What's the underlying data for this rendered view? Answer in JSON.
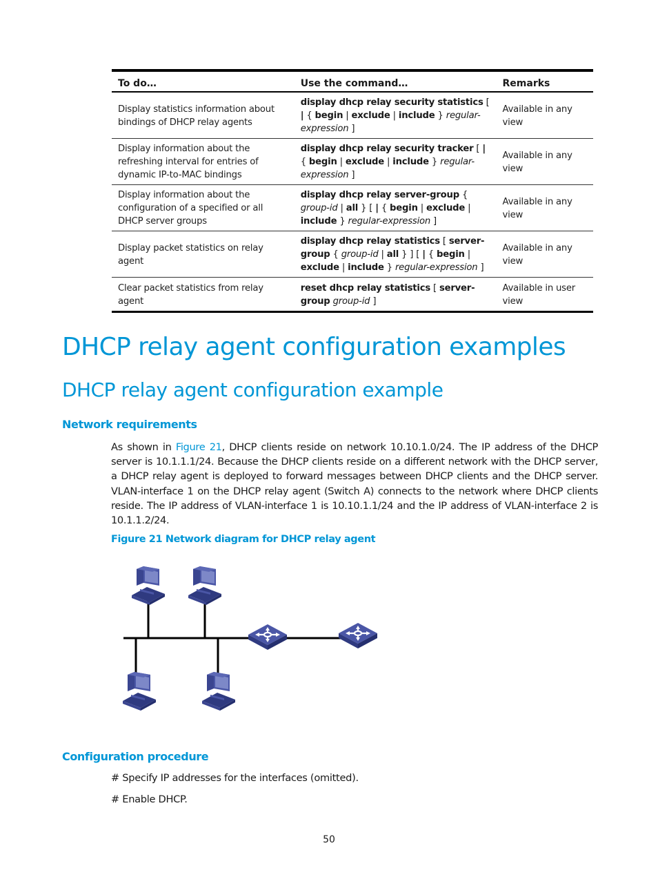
{
  "table": {
    "headers": [
      "To do…",
      "Use the command…",
      "Remarks"
    ],
    "rows": [
      {
        "todo": "Display statistics information about bindings of DHCP relay agents",
        "command": [
          {
            "t": "display dhcp relay security statistics",
            "s": "b"
          },
          {
            "t": " [ ",
            "s": ""
          },
          {
            "t": "|",
            "s": "b"
          },
          {
            "t": " { ",
            "s": ""
          },
          {
            "t": "begin",
            "s": "b"
          },
          {
            "t": " | ",
            "s": ""
          },
          {
            "t": "exclude",
            "s": "b"
          },
          {
            "t": " | ",
            "s": ""
          },
          {
            "t": "include",
            "s": "b"
          },
          {
            "t": " } ",
            "s": ""
          },
          {
            "t": "regular-expression",
            "s": "i"
          },
          {
            "t": " ]",
            "s": ""
          }
        ],
        "remarks": "Available in any view"
      },
      {
        "todo": "Display information about the refreshing interval for entries of dynamic IP-to-MAC bindings",
        "command": [
          {
            "t": "display dhcp relay security tracker",
            "s": "b"
          },
          {
            "t": " [ ",
            "s": ""
          },
          {
            "t": "|",
            "s": "b"
          },
          {
            "t": " { ",
            "s": ""
          },
          {
            "t": "begin",
            "s": "b"
          },
          {
            "t": " | ",
            "s": ""
          },
          {
            "t": "exclude",
            "s": "b"
          },
          {
            "t": " | ",
            "s": ""
          },
          {
            "t": "include",
            "s": "b"
          },
          {
            "t": " } ",
            "s": ""
          },
          {
            "t": "regular-expression",
            "s": "i"
          },
          {
            "t": " ]",
            "s": ""
          }
        ],
        "remarks": "Available in any view"
      },
      {
        "todo": "Display information about the configuration of a specified or all DHCP server groups",
        "command": [
          {
            "t": "display dhcp relay server-group",
            "s": "b"
          },
          {
            "t": " { ",
            "s": ""
          },
          {
            "t": "group-id",
            "s": "i"
          },
          {
            "t": " | ",
            "s": ""
          },
          {
            "t": "all",
            "s": "b"
          },
          {
            "t": " } [ ",
            "s": ""
          },
          {
            "t": "|",
            "s": "b"
          },
          {
            "t": " { ",
            "s": ""
          },
          {
            "t": "begin",
            "s": "b"
          },
          {
            "t": " | ",
            "s": ""
          },
          {
            "t": "exclude",
            "s": "b"
          },
          {
            "t": " | ",
            "s": ""
          },
          {
            "t": "include",
            "s": "b"
          },
          {
            "t": " } ",
            "s": ""
          },
          {
            "t": "regular-expression",
            "s": "i"
          },
          {
            "t": " ]",
            "s": ""
          }
        ],
        "remarks": "Available in any view"
      },
      {
        "todo": "Display packet statistics on relay agent",
        "command": [
          {
            "t": "display dhcp relay statistics",
            "s": "b"
          },
          {
            "t": " [ ",
            "s": ""
          },
          {
            "t": "server-group",
            "s": "b"
          },
          {
            "t": " { ",
            "s": ""
          },
          {
            "t": "group-id",
            "s": "i"
          },
          {
            "t": " | ",
            "s": ""
          },
          {
            "t": "all",
            "s": "b"
          },
          {
            "t": " } ] [ ",
            "s": ""
          },
          {
            "t": "|",
            "s": "b"
          },
          {
            "t": " { ",
            "s": ""
          },
          {
            "t": "begin",
            "s": "b"
          },
          {
            "t": " | ",
            "s": ""
          },
          {
            "t": "exclude",
            "s": "b"
          },
          {
            "t": " | ",
            "s": ""
          },
          {
            "t": "include",
            "s": "b"
          },
          {
            "t": " } ",
            "s": ""
          },
          {
            "t": "regular-expression",
            "s": "i"
          },
          {
            "t": " ]",
            "s": ""
          }
        ],
        "remarks": "Available in any view"
      },
      {
        "todo": "Clear packet statistics from relay agent",
        "command": [
          {
            "t": "reset dhcp relay statistics",
            "s": "b"
          },
          {
            "t": " [ ",
            "s": ""
          },
          {
            "t": "server-group",
            "s": "b"
          },
          {
            "t": " ",
            "s": ""
          },
          {
            "t": "group-id",
            "s": "i"
          },
          {
            "t": " ]",
            "s": ""
          }
        ],
        "remarks": "Available in user view"
      }
    ]
  },
  "headings": {
    "h1": "DHCP relay agent configuration examples",
    "h2": "DHCP relay agent configuration example",
    "network_requirements": "Network requirements",
    "configuration_procedure": "Configuration procedure"
  },
  "paragraph": {
    "before_link": "As shown in ",
    "link": "Figure 21",
    "after_link": ", DHCP clients reside on network 10.10.1.0/24. The IP address of the DHCP server is 10.1.1.1/24. Because the DHCP clients reside on a different network with the DHCP server, a DHCP relay agent is deployed to forward messages between DHCP clients and the DHCP server. VLAN-interface 1 on the DHCP relay agent (Switch A) connects to the network where DHCP clients reside. The IP address of VLAN-interface 1 is 10.10.1.1/24 and the IP address of VLAN-interface 2 is 10.1.1.2/24."
  },
  "figure": {
    "caption": "Figure 21 Network diagram for DHCP relay agent",
    "switch_label": "SWITCH",
    "colors": {
      "device": "#4a56a6",
      "device_dark": "#2f3a80",
      "screen": "#7d88c8",
      "line": "#000000"
    }
  },
  "steps": [
    "# Specify IP addresses for the interfaces (omitted).",
    "# Enable DHCP."
  ],
  "page_number": "50"
}
